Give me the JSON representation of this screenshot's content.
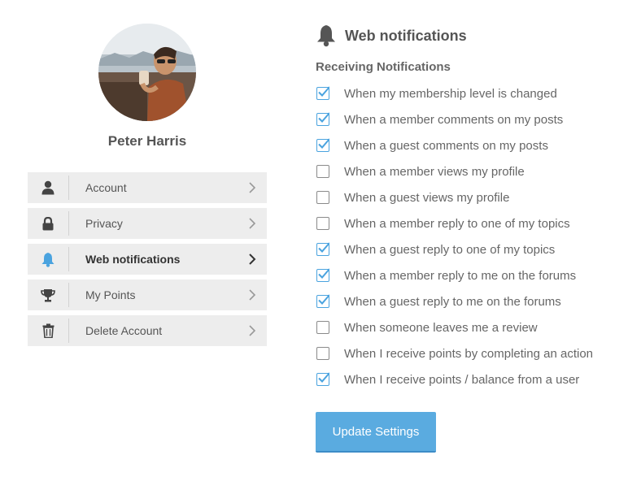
{
  "profile": {
    "name": "Peter Harris"
  },
  "menu": {
    "items": [
      {
        "label": "Account",
        "icon": "user-icon",
        "active": false
      },
      {
        "label": "Privacy",
        "icon": "lock-icon",
        "active": false
      },
      {
        "label": "Web notifications",
        "icon": "bell-icon",
        "active": true
      },
      {
        "label": "My Points",
        "icon": "trophy-icon",
        "active": false
      },
      {
        "label": "Delete Account",
        "icon": "trash-icon",
        "active": false
      }
    ]
  },
  "notifications": {
    "title": "Web notifications",
    "icon": "bell-icon",
    "subheading": "Receiving Notifications",
    "options": [
      {
        "label": "When my membership level is changed",
        "checked": true
      },
      {
        "label": "When a member comments on my posts",
        "checked": true
      },
      {
        "label": "When a guest comments on my posts",
        "checked": true
      },
      {
        "label": "When a member views my profile",
        "checked": false
      },
      {
        "label": "When a guest views my profile",
        "checked": false
      },
      {
        "label": "When a member reply to one of my topics",
        "checked": false
      },
      {
        "label": "When a guest reply to one of my topics",
        "checked": true
      },
      {
        "label": "When a member reply to me on the forums",
        "checked": true
      },
      {
        "label": "When a guest reply to me on the forums",
        "checked": true
      },
      {
        "label": "When someone leaves me a review",
        "checked": false
      },
      {
        "label": "When I receive points by completing an action",
        "checked": false
      },
      {
        "label": "When I receive points / balance from a user",
        "checked": true
      }
    ],
    "submit_label": "Update Settings"
  },
  "colors": {
    "accent": "#5aabe0",
    "active_icon": "#4aa3df",
    "icon": "#444444",
    "menu_bg": "#ededed"
  }
}
